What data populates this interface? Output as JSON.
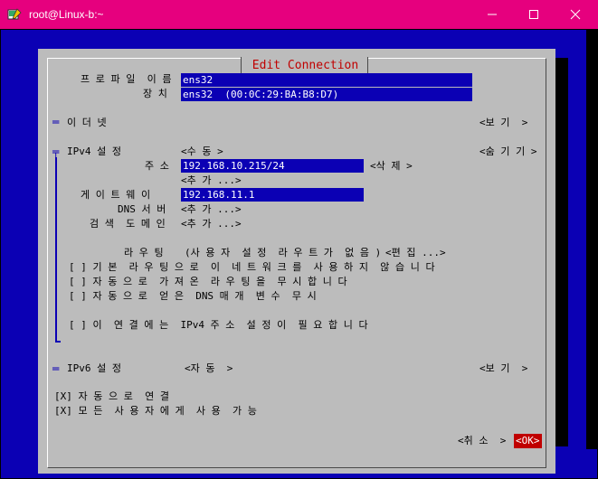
{
  "window": {
    "title": "root@Linux-b:~",
    "icons": [
      "terminal-app-icon",
      "minimize-icon",
      "maximize-icon",
      "close-icon"
    ]
  },
  "dialog": {
    "title": "Edit Connection",
    "profile_name_label": "프 로 파 일  이 름",
    "profile_name_value": "ens32",
    "device_label": "장 치",
    "device_value": "ens32  (00:0C:29:BA:B8:D7)",
    "ethernet": {
      "label": "이 더 넷",
      "toggle": "<보 기  >"
    },
    "ipv4": {
      "label": "IPv4 설 정",
      "mode": "<수 동 >",
      "toggle": "<숨 기 기 >",
      "address_label": "주 소",
      "address_value": "192.168.10.215/24",
      "delete": "<삭 제 >",
      "add_address": "<추 가 ...>",
      "gateway_label": "게 이 트 웨 이",
      "gateway_value": "192.168.11.1",
      "dns_label": "DNS 서 버",
      "dns_add": "<추 가 ...>",
      "search_label": "검 색  도 메 인",
      "search_add": "<추 가 ...>",
      "routing_label": "라 우 팅",
      "routing_value": "(사 용 자  설 정  라 우 트 가  없 음 )",
      "routing_edit": "<편 집 ...>",
      "checkbox_never_default": "[ ] 기 본  라 우 팅 으 로  이  네 트 워 크 를  사 용 하 지  않 습 니 다",
      "checkbox_ignore_routes": "[ ] 자 동 으 로  가 져 온  라 우 팅 을  무 시 합 니 다",
      "checkbox_ignore_dns": "[ ] 자 동 으 로  얻 은  DNS 매 개  변 수  무 시",
      "checkbox_required": "[ ] 이  연 결 에 는  IPv4 주 소  설 정 이  필 요 합 니 다"
    },
    "ipv6": {
      "label": "IPv6 설 정",
      "mode": "<자 동  >",
      "toggle": "<보 기  >"
    },
    "autoconnect": "[X] 자 동 으 로  연 결",
    "all_users": "[X] 모 든  사 용 자 에 게  사 용  가 능",
    "cancel": "<취 소  >",
    "ok": "<OK>"
  },
  "colors": {
    "titlebar": "#e6007e",
    "terminal_blue": "#0b00b4",
    "dialog_gray": "#bcbcbc",
    "accent_red": "#c00000"
  }
}
